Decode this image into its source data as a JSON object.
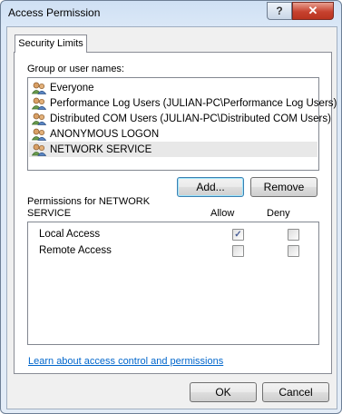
{
  "window": {
    "title": "Access Permission",
    "help_label": "?",
    "close_label": "✕"
  },
  "tab": {
    "label": "Security Limits"
  },
  "groups": {
    "label": "Group or user names:",
    "items": [
      {
        "name": "Everyone"
      },
      {
        "name": "Performance Log Users (JULIAN-PC\\Performance Log Users)"
      },
      {
        "name": "Distributed COM Users (JULIAN-PC\\Distributed COM Users)"
      },
      {
        "name": "ANONYMOUS LOGON"
      },
      {
        "name": "NETWORK SERVICE"
      }
    ],
    "selected": "NETWORK SERVICE"
  },
  "buttons": {
    "add": "Add...",
    "remove": "Remove",
    "ok": "OK",
    "cancel": "Cancel"
  },
  "permissions": {
    "label": "Permissions for NETWORK SERVICE",
    "allow_header": "Allow",
    "deny_header": "Deny",
    "rows": [
      {
        "name": "Local Access",
        "allow": true,
        "deny": false
      },
      {
        "name": "Remote Access",
        "allow": false,
        "deny": false
      }
    ]
  },
  "link": {
    "text": "Learn about access control and permissions"
  },
  "colors": {
    "link": "#0066cc",
    "close_button": "#c7422f",
    "titlebar": "#cfe0f4"
  }
}
